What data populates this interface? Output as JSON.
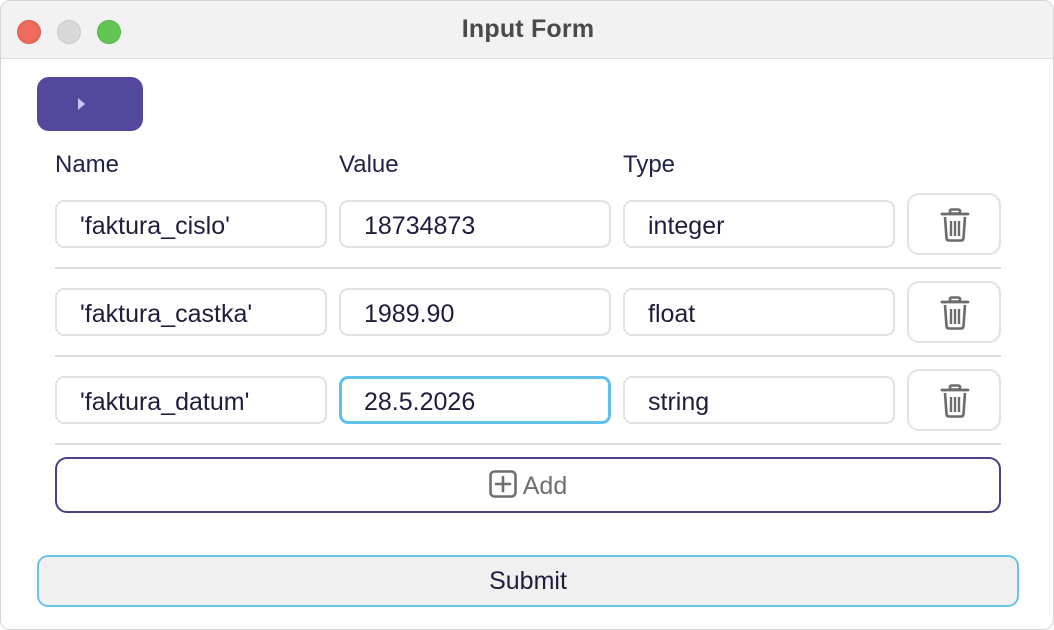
{
  "window": {
    "title": "Input Form"
  },
  "toolbar": {
    "toggle_icon": "caret-right-icon"
  },
  "columns": {
    "name": "Name",
    "value": "Value",
    "type": "Type"
  },
  "rows": [
    {
      "name": "'faktura_cislo'",
      "value": "18734873",
      "type": "integer",
      "delete_icon": "trash-icon"
    },
    {
      "name": "'faktura_castka'",
      "value": "1989.90",
      "type": "float",
      "delete_icon": "trash-icon"
    },
    {
      "name": "'faktura_datum'",
      "value": "28.5.2026",
      "type": "string",
      "delete_icon": "trash-icon"
    }
  ],
  "actions": {
    "add_label": "Add",
    "add_icon": "plus-square-icon",
    "submit_label": "Submit"
  },
  "colors": {
    "accent": "#53489c",
    "focus": "#5fc0ea",
    "text": "#1e1d3d"
  }
}
